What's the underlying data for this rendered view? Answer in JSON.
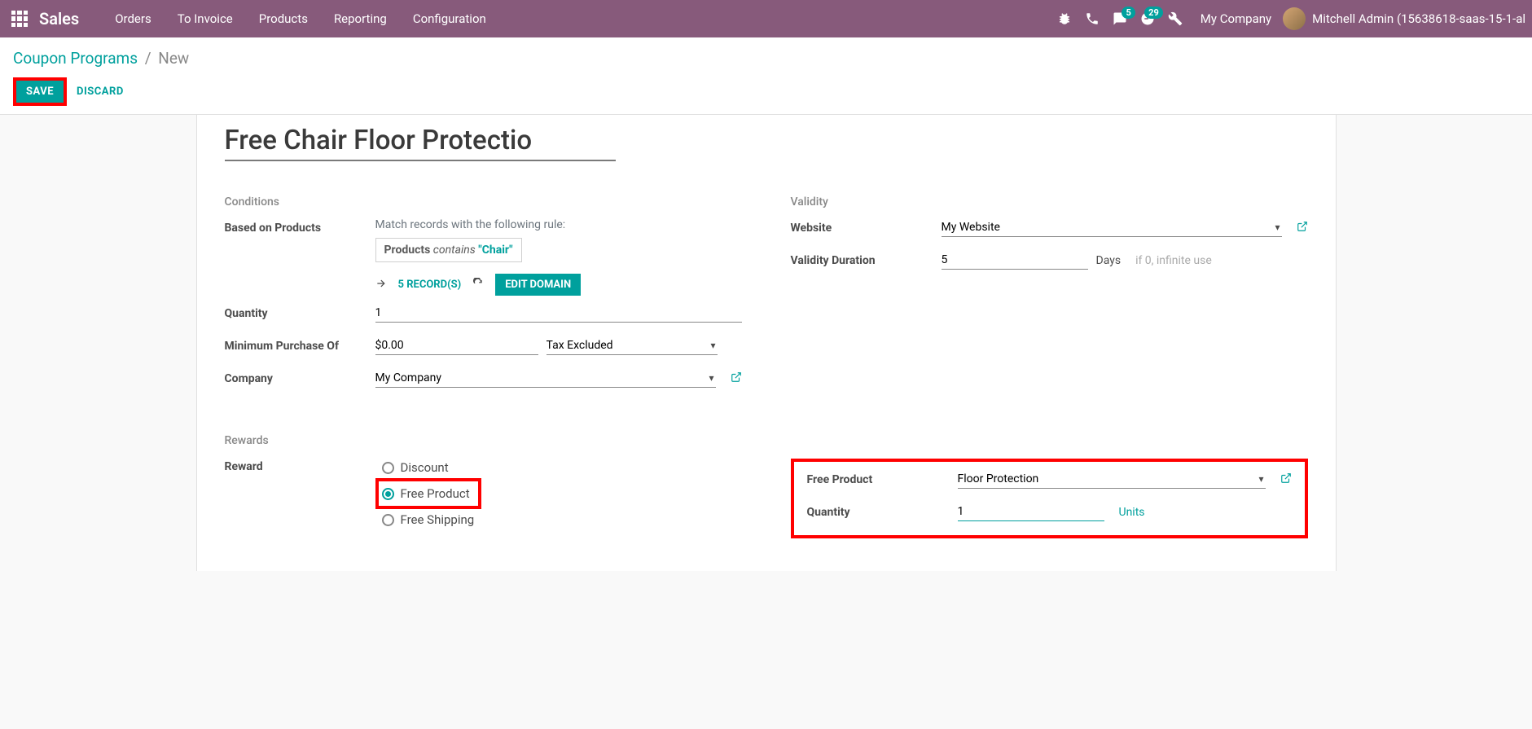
{
  "topbar": {
    "brand": "Sales",
    "nav": [
      "Orders",
      "To Invoice",
      "Products",
      "Reporting",
      "Configuration"
    ],
    "messages_badge": "5",
    "activities_badge": "29",
    "company": "My Company",
    "user": "Mitchell Admin (15638618-saas-15-1-al"
  },
  "breadcrumb": {
    "parent": "Coupon Programs",
    "current": "New"
  },
  "actions": {
    "save": "SAVE",
    "discard": "DISCARD"
  },
  "record_title": "Free Chair Floor Protectio",
  "conditions": {
    "section": "Conditions",
    "based_on_products_label": "Based on Products",
    "match_text": "Match records with the following rule:",
    "domain_products": "Products",
    "domain_contains": "contains",
    "domain_value": "\"Chair\"",
    "records_link": "5 RECORD(S)",
    "edit_domain": "EDIT DOMAIN",
    "quantity_label": "Quantity",
    "quantity_value": "1",
    "min_purchase_label": "Minimum Purchase Of",
    "min_purchase_value": "$0.00",
    "tax_option": "Tax Excluded",
    "company_label": "Company",
    "company_value": "My Company"
  },
  "validity": {
    "section": "Validity",
    "website_label": "Website",
    "website_value": "My Website",
    "duration_label": "Validity Duration",
    "duration_value": "5",
    "days_label": "Days",
    "days_hint": "if 0, infinite use"
  },
  "rewards": {
    "section": "Rewards",
    "reward_label": "Reward",
    "options": {
      "discount": "Discount",
      "free_product": "Free Product",
      "free_shipping": "Free Shipping"
    },
    "free_product_label": "Free Product",
    "free_product_value": "Floor Protection",
    "quantity_label": "Quantity",
    "quantity_value": "1",
    "quantity_unit": "Units"
  }
}
